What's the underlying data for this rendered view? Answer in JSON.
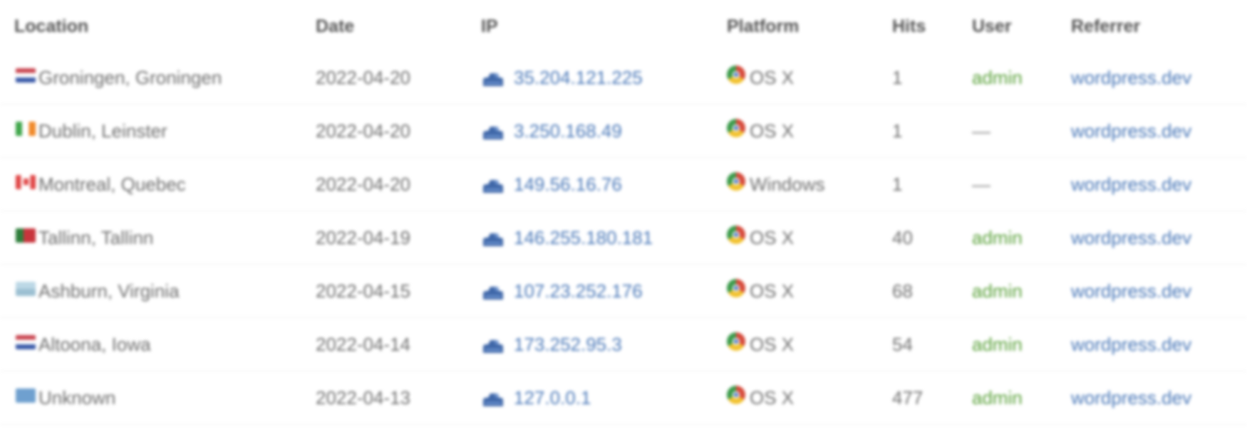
{
  "headers": {
    "location": "Location",
    "date": "Date",
    "ip": "IP",
    "platform": "Platform",
    "hits": "Hits",
    "user": "User",
    "referrer": "Referrer"
  },
  "rows": [
    {
      "flag": "flag-nl",
      "location": "Groningen, Groningen",
      "date": "2022-04-20",
      "ip": "35.204.121.225",
      "browser_icon": "chrome-icon",
      "platform": "OS X",
      "hits": "1",
      "user": "admin",
      "referrer": "wordpress.dev"
    },
    {
      "flag": "flag-ie",
      "location": "Dublin, Leinster",
      "date": "2022-04-20",
      "ip": "3.250.168.49",
      "browser_icon": "chrome-icon",
      "platform": "OS X",
      "hits": "1",
      "user": "—",
      "referrer": "wordpress.dev"
    },
    {
      "flag": "flag-ca",
      "location": "Montreal, Quebec",
      "date": "2022-04-20",
      "ip": "149.56.16.76",
      "browser_icon": "chrome-icon",
      "platform": "Windows",
      "hits": "1",
      "user": "—",
      "referrer": "wordpress.dev"
    },
    {
      "flag": "flag-ee",
      "location": "Tallinn, Tallinn",
      "date": "2022-04-19",
      "ip": "146.255.180.181",
      "browser_icon": "chrome-icon",
      "platform": "OS X",
      "hits": "40",
      "user": "admin",
      "referrer": "wordpress.dev"
    },
    {
      "flag": "flag-us",
      "location": "Ashburn, Virginia",
      "date": "2022-04-15",
      "ip": "107.23.252.176",
      "browser_icon": "chrome-icon",
      "platform": "OS X",
      "hits": "68",
      "user": "admin",
      "referrer": "wordpress.dev"
    },
    {
      "flag": "flag-nl",
      "location": "Altoona, Iowa",
      "date": "2022-04-14",
      "ip": "173.252.95.3",
      "browser_icon": "chrome-icon",
      "platform": "OS X",
      "hits": "54",
      "user": "admin",
      "referrer": "wordpress.dev"
    },
    {
      "flag": "flag-unknown",
      "location": "Unknown",
      "date": "2022-04-13",
      "ip": "127.0.0.1",
      "browser_icon": "chrome-icon",
      "platform": "OS X",
      "hits": "477",
      "user": "admin",
      "referrer": "wordpress.dev"
    }
  ],
  "colors": {
    "link": "#4a78b8",
    "user_admin": "#5aa13a",
    "text": "#6e6e6e"
  }
}
